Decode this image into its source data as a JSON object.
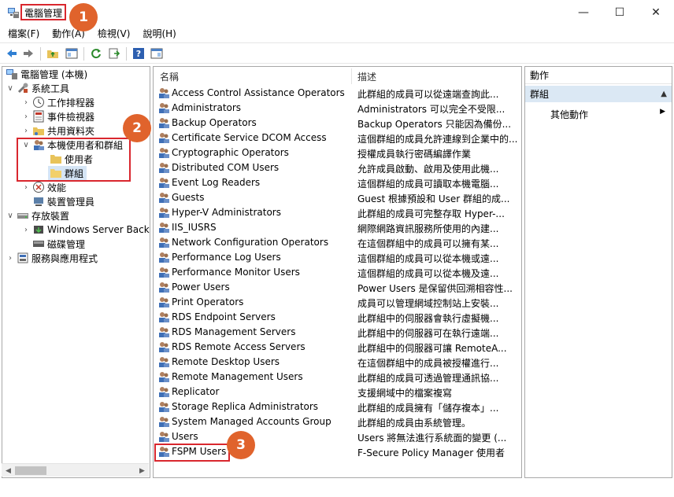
{
  "window": {
    "title": "電腦管理",
    "minimize_glyph": "—",
    "maximize_glyph": "☐",
    "close_glyph": "✕"
  },
  "menu": [
    "檔案(F)",
    "動作(A)",
    "檢視(V)",
    "說明(H)"
  ],
  "toolbar": [
    "back-arrow-icon",
    "forward-arrow-icon",
    "up-folder-icon",
    "show-hide-tree-icon",
    "refresh-icon",
    "export-list-icon",
    "help-icon",
    "properties-icon"
  ],
  "tree": [
    {
      "label": "電腦管理 (本機)",
      "caret": "",
      "icon": "computer-management-icon"
    },
    {
      "label": "系統工具",
      "caret": "∨",
      "icon": "tools-icon"
    },
    {
      "label": "工作排程器",
      "caret": "›",
      "icon": "clock-icon"
    },
    {
      "label": "事件檢視器",
      "caret": "›",
      "icon": "event-viewer-icon"
    },
    {
      "label": "共用資料夾",
      "caret": "›",
      "icon": "shared-folder-icon"
    },
    {
      "label": "本機使用者和群組",
      "caret": "∨",
      "icon": "users-groups-icon"
    },
    {
      "label": "使用者",
      "caret": "",
      "icon": "folder-icon"
    },
    {
      "label": "群組",
      "caret": "",
      "icon": "folder-icon"
    },
    {
      "label": "效能",
      "caret": "›",
      "icon": "performance-icon"
    },
    {
      "label": "裝置管理員",
      "caret": "",
      "icon": "device-manager-icon"
    },
    {
      "label": "存放裝置",
      "caret": "∨",
      "icon": "storage-icon"
    },
    {
      "label": "Windows Server Backup",
      "caret": "›",
      "icon": "backup-icon"
    },
    {
      "label": "磁碟管理",
      "caret": "",
      "icon": "disk-icon"
    },
    {
      "label": "服務與應用程式",
      "caret": "›",
      "icon": "services-icon"
    }
  ],
  "list": {
    "columns": {
      "name": "名稱",
      "description": "描述"
    },
    "rows": [
      {
        "name": "Access Control Assistance Operators",
        "desc": "此群組的成員可以從遠端查詢此..."
      },
      {
        "name": "Administrators",
        "desc": "Administrators 可以完全不受限..."
      },
      {
        "name": "Backup Operators",
        "desc": "Backup Operators 只能因為備份..."
      },
      {
        "name": "Certificate Service DCOM Access",
        "desc": "這個群組的成員允許連線到企業中的..."
      },
      {
        "name": "Cryptographic Operators",
        "desc": "授權成員執行密碼編譯作業"
      },
      {
        "name": "Distributed COM Users",
        "desc": "允許成員啟動、啟用及使用此機..."
      },
      {
        "name": "Event Log Readers",
        "desc": "這個群組的成員可讀取本機電腦..."
      },
      {
        "name": "Guests",
        "desc": "Guest 根據預設和 User 群組的成..."
      },
      {
        "name": "Hyper-V Administrators",
        "desc": "此群組的成員可完整存取 Hyper-..."
      },
      {
        "name": "IIS_IUSRS",
        "desc": "網際網路資訊服務所使用的內建..."
      },
      {
        "name": "Network Configuration Operators",
        "desc": "在這個群組中的成員可以擁有某..."
      },
      {
        "name": "Performance Log Users",
        "desc": "這個群組的成員可以從本機或遠..."
      },
      {
        "name": "Performance Monitor Users",
        "desc": "這個群組的成員可以從本機及遠..."
      },
      {
        "name": "Power Users",
        "desc": "Power Users 是保留供回溯相容性..."
      },
      {
        "name": "Print Operators",
        "desc": "成員可以管理網域控制站上安裝..."
      },
      {
        "name": "RDS Endpoint Servers",
        "desc": "此群組中的伺服器會執行虛擬機..."
      },
      {
        "name": "RDS Management Servers",
        "desc": "此群組中的伺服器可在執行遠端..."
      },
      {
        "name": "RDS Remote Access Servers",
        "desc": "此群組中的伺服器可讓 RemoteA..."
      },
      {
        "name": "Remote Desktop Users",
        "desc": "在這個群組中的成員被授權進行..."
      },
      {
        "name": "Remote Management Users",
        "desc": "此群組的成員可透過管理通訊協..."
      },
      {
        "name": "Replicator",
        "desc": "支援網域中的檔案複寫"
      },
      {
        "name": "Storage Replica Administrators",
        "desc": "此群組的成員擁有「儲存複本」..."
      },
      {
        "name": "System Managed Accounts Group",
        "desc": "此群組的成員由系統管理。"
      },
      {
        "name": "Users",
        "desc": "Users 將無法進行系統面的變更 (..."
      },
      {
        "name": "FSPM Users",
        "desc": "F-Secure Policy Manager 使用者"
      }
    ]
  },
  "actions": {
    "header": "動作",
    "group": "群組",
    "group_arrow": "▲",
    "more": "其他動作",
    "more_arrow": "▶"
  },
  "scrollbar": {
    "left_glyph": "◀",
    "right_glyph": "▶"
  },
  "callouts": [
    "1",
    "2",
    "3"
  ],
  "colors": {
    "callout": "#e0632c",
    "highlight_box": "#d9272e",
    "selection": "#dbe8f4",
    "pane_border": "#a8a8a8"
  }
}
